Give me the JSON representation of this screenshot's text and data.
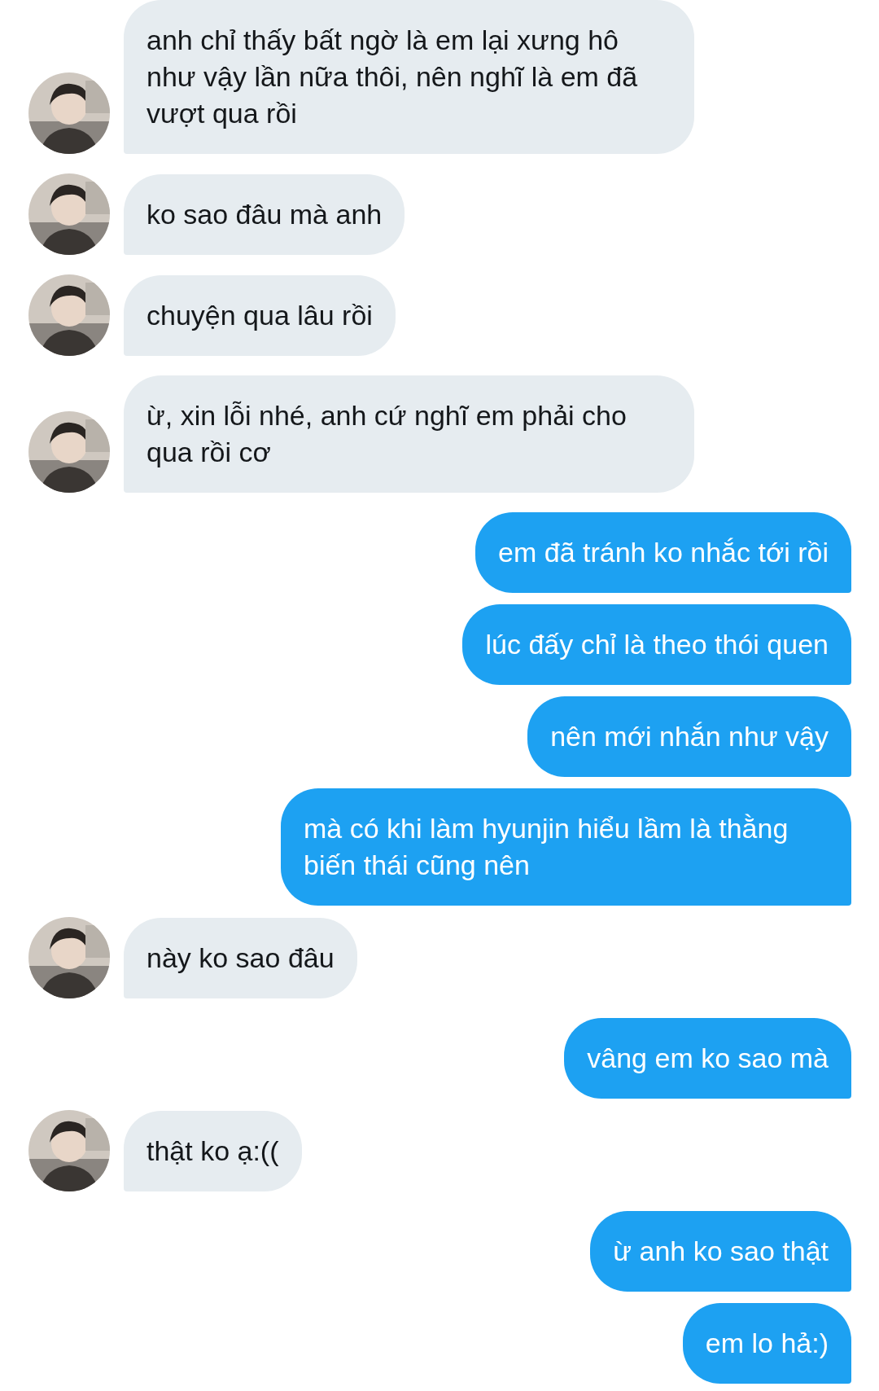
{
  "messages": [
    {
      "kind": "received",
      "text": "anh chỉ thấy bất ngờ là em lại xưng hô như vậy lần nữa thôi, nên nghĩ là em đã vượt qua rồi"
    },
    {
      "kind": "received",
      "text": "ko sao đâu mà anh"
    },
    {
      "kind": "received",
      "text": "chuyện qua lâu rồi"
    },
    {
      "kind": "received",
      "text": "ừ, xin lỗi nhé, anh cứ nghĩ em phải cho qua rồi cơ"
    },
    {
      "kind": "sent",
      "text": "em đã tránh ko nhắc tới rồi"
    },
    {
      "kind": "sent",
      "text": "lúc đấy chỉ là theo thói quen"
    },
    {
      "kind": "sent",
      "text": "nên mới nhắn như vậy"
    },
    {
      "kind": "sent",
      "text": "mà có khi làm hyunjin hiểu lầm là thằng biến thái cũng nên"
    },
    {
      "kind": "received",
      "text": "này ko sao đâu"
    },
    {
      "kind": "sent",
      "text": "vâng em ko sao mà"
    },
    {
      "kind": "received",
      "text": "thật ko ạ:(("
    },
    {
      "kind": "sent",
      "text": "ừ anh ko sao thật"
    },
    {
      "kind": "sent",
      "text": "em lo hả:)"
    }
  ]
}
